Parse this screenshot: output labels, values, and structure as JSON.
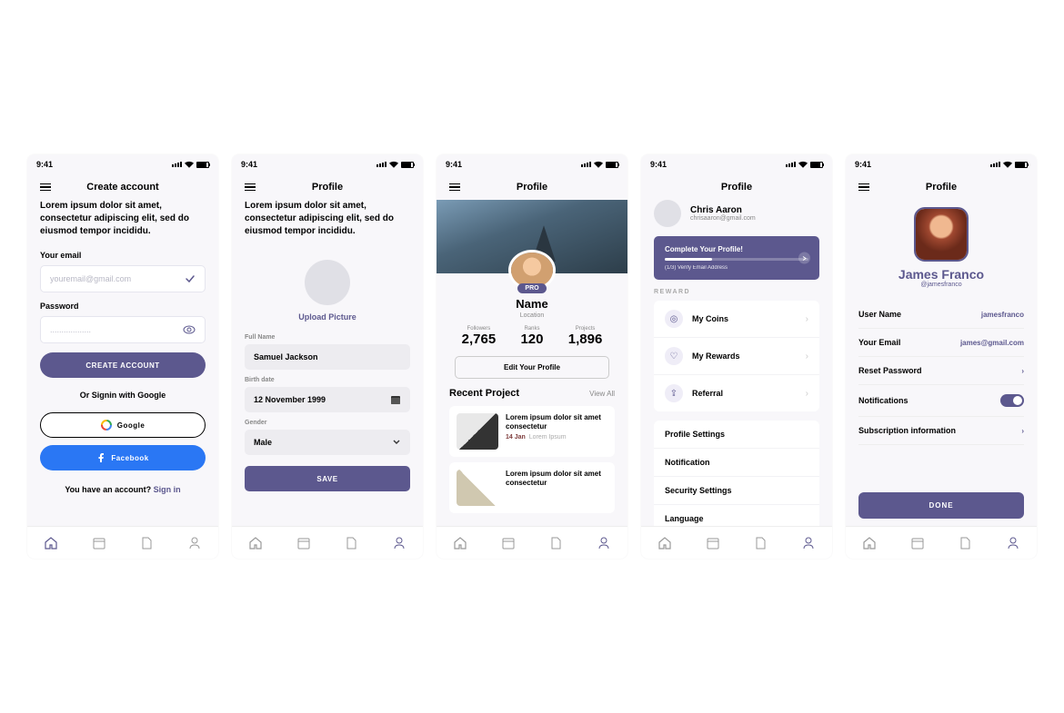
{
  "status": {
    "time": "9:41"
  },
  "screen1": {
    "title": "Create account",
    "desc": "Lorem ipsum dolor sit amet, consectetur adipiscing elit, sed do eiusmod tempor incididu.",
    "email_label": "Your email",
    "email_placeholder": "youremail@gmail.com",
    "password_label": "Password",
    "password_placeholder": "..................",
    "create_btn": "CREATE ACCOUNT",
    "or_txt": "Or Signin with Google",
    "google_btn": "Google",
    "facebook_btn": "Facebook",
    "signin_q": "You have an account? ",
    "signin_link": "Sign in"
  },
  "screen2": {
    "title": "Profile",
    "desc": "Lorem ipsum dolor sit amet, consectetur adipiscing elit, sed do eiusmod tempor incididu.",
    "upload": "Upload Picture",
    "name_lbl": "Full Name",
    "name_val": "Samuel Jackson",
    "birth_lbl": "Birth date",
    "birth_val": "12 November 1999",
    "gender_lbl": "Gender",
    "gender_val": "Male",
    "save_btn": "SAVE"
  },
  "screen3": {
    "title": "Profile",
    "pro": "PRO",
    "name": "Name",
    "location": "Location",
    "stats": [
      {
        "label": "Followers",
        "value": "2,765"
      },
      {
        "label": "Ranks",
        "value": "120"
      },
      {
        "label": "Projects",
        "value": "1,896"
      }
    ],
    "edit_btn": "Edit Your Profile",
    "recent": "Recent Project",
    "view_all": "View All",
    "projects": [
      {
        "title": "Lorem ipsum dolor sit amet consectetur",
        "date": "14 Jan",
        "sub": "Lorem Ipsum"
      },
      {
        "title": "Lorem ipsum dolor sit amet consectetur",
        "date": "",
        "sub": ""
      }
    ]
  },
  "screen4": {
    "title": "Profile",
    "user": "Chris Aaron",
    "email": "chrisaaron@gmail.com",
    "comp_title": "Complete Your Profile!",
    "comp_sub": "(1/3) Verify Email Address",
    "section": "REWARD",
    "rewards": [
      "My Coins",
      "My Rewards",
      "Referral"
    ],
    "reward_icons": [
      "◎",
      "♡",
      "⇪"
    ],
    "settings": [
      "Profile Settings",
      "Notification",
      "Security Settings",
      "Language"
    ]
  },
  "screen5": {
    "title": "Profile",
    "name": "James Franco",
    "handle": "@jamesfranco",
    "rows": [
      {
        "label": "User Name",
        "value": "jamesfranco",
        "type": "text"
      },
      {
        "label": "Your Email",
        "value": "james@gmail.com",
        "type": "text"
      },
      {
        "label": "Reset Password",
        "value": "",
        "type": "chev"
      },
      {
        "label": "Notifications",
        "value": "",
        "type": "toggle"
      },
      {
        "label": "Subscription information",
        "value": "",
        "type": "chev"
      }
    ],
    "done": "DONE"
  }
}
